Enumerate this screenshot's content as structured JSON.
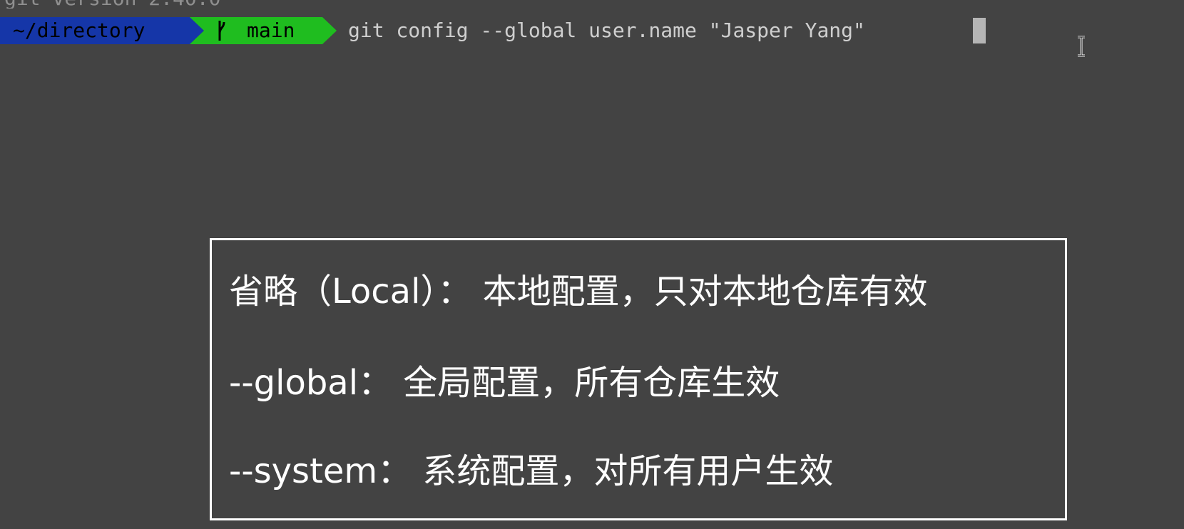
{
  "terminal": {
    "previous_line": "git version 2.40.0",
    "prompt": {
      "directory": "~/directory",
      "branch_icon": "git-branch-icon",
      "branch": "main"
    },
    "command": "git config --global user.name \"Jasper Yang\"",
    "colors": {
      "background": "#434343",
      "directory_segment": "#1536a8",
      "branch_segment": "#1fbd1f",
      "command_text": "#cfcfcf",
      "cursor": "#b5b5b5"
    }
  },
  "info_box": {
    "lines": [
      "省略（Local）： 本地配置，只对本地仓库有效",
      "--global： 全局配置，所有仓库生效",
      "--system： 系统配置，对所有用户生效"
    ],
    "border_color": "#ffffff",
    "text_color": "#ffffff"
  },
  "pointer": {
    "icon": "text-cursor-ibeam-icon"
  }
}
